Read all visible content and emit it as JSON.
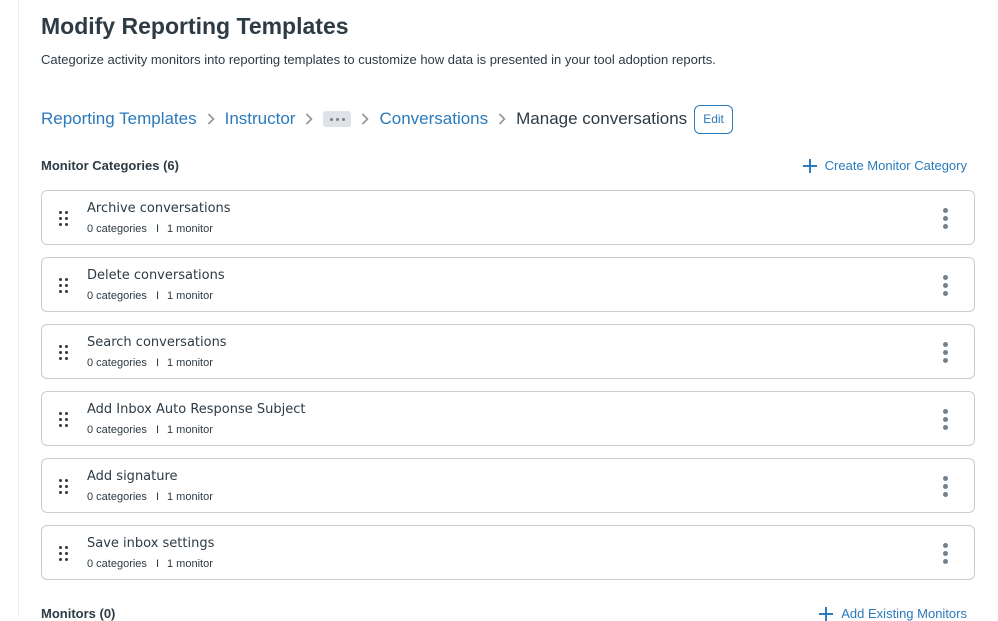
{
  "header": {
    "title": "Modify Reporting Templates",
    "description": "Categorize activity monitors into reporting templates to customize how data is presented in your tool adoption reports."
  },
  "breadcrumb": {
    "items": [
      "Reporting Templates",
      "Instructor",
      "Conversations"
    ],
    "current": "Manage conversations",
    "edit_label": "Edit"
  },
  "categories_section": {
    "title": "Monitor Categories (6)",
    "create_label": "Create Monitor Category"
  },
  "categories": [
    {
      "name": "Archive conversations",
      "categories": "0 categories",
      "monitors": "1 monitor"
    },
    {
      "name": "Delete conversations",
      "categories": "0 categories",
      "monitors": "1 monitor"
    },
    {
      "name": "Search conversations",
      "categories": "0 categories",
      "monitors": "1 monitor"
    },
    {
      "name": "Add Inbox Auto Response Subject",
      "categories": "0 categories",
      "monitors": "1 monitor"
    },
    {
      "name": "Add signature",
      "categories": "0 categories",
      "monitors": "1 monitor"
    },
    {
      "name": "Save inbox settings",
      "categories": "0 categories",
      "monitors": "1 monitor"
    }
  ],
  "monitors_section": {
    "title": "Monitors (0)",
    "add_label": "Add Existing Monitors"
  },
  "meta_separator": "I",
  "icons": {
    "breadcrumb_sep": "chevron-right-icon",
    "overflow": "ellipsis-icon",
    "create": "plus-icon",
    "drag": "drag-handle-icon",
    "menu": "kebab-menu-icon"
  },
  "colors": {
    "link": "#2b7abc",
    "text": "#2d3b45",
    "border": "#c7cdd1",
    "muted": "#73818c"
  }
}
